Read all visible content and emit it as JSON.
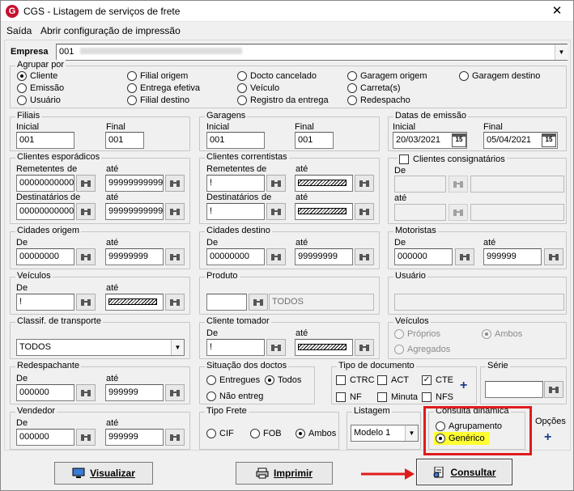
{
  "window": {
    "title": "CGS - Listagem de serviços de frete",
    "close": "✕",
    "logo": "G"
  },
  "menu": {
    "saida": "Saída",
    "config": "Abrir configuração de impressão"
  },
  "empresa": {
    "label": "Empresa",
    "value": "001"
  },
  "agrupar": {
    "legend": "Agrupar por",
    "options": [
      "Cliente",
      "Emissão",
      "Usuário",
      "Filial origem",
      "Entrega efetiva",
      "Filial destino",
      "Docto cancelado",
      "Veículo",
      "Registro da entrega",
      "Garagem origem",
      "Carreta(s)",
      "Redespacho",
      "Garagem destino"
    ],
    "selected": "Cliente"
  },
  "filiais": {
    "legend": "Filiais",
    "inicial_label": "Inicial",
    "final_label": "Final",
    "inicial": "001",
    "final": "001"
  },
  "garagens": {
    "legend": "Garagens",
    "inicial_label": "Inicial",
    "final_label": "Final",
    "inicial": "001",
    "final": "001"
  },
  "datas": {
    "legend": "Datas de emissão",
    "inicial_label": "Inicial",
    "final_label": "Final",
    "inicial": "20/03/2021",
    "final": "05/04/2021",
    "cal": "15"
  },
  "clientes_esporadicos": {
    "legend": "Clientes esporádicos",
    "rem_label": "Remetentes",
    "de": "de",
    "ate": "até",
    "rem_de": "00000000000",
    "rem_ate": "99999999999",
    "dest_label": "Destinatários",
    "dest_de": "00000000000",
    "dest_ate": "99999999999"
  },
  "clientes_correntistas": {
    "legend": "Clientes correntistas",
    "rem_label": "Remetentes",
    "de": "de",
    "ate": "até",
    "rem_de": "!",
    "dest_label": "Destinatários",
    "dest_de": "!"
  },
  "consignatarios": {
    "legend": "Clientes consignatários",
    "de": "De",
    "ate": "até"
  },
  "cidades_origem": {
    "legend": "Cidades origem",
    "de": "De",
    "ate": "até",
    "v_de": "00000000",
    "v_ate": "99999999"
  },
  "cidades_destino": {
    "legend": "Cidades destino",
    "de": "De",
    "ate": "até",
    "v_de": "00000000",
    "v_ate": "99999999"
  },
  "motoristas": {
    "legend": "Motoristas",
    "de": "De",
    "ate": "até",
    "v_de": "000000",
    "v_ate": "999999"
  },
  "veiculos": {
    "legend": "Veículos",
    "de": "De",
    "ate": "até",
    "v_de": "!"
  },
  "produto": {
    "legend": "Produto",
    "value": "TODOS"
  },
  "usuario": {
    "legend": "Usuário"
  },
  "classif": {
    "legend": "Classif. de transporte",
    "value": "TODOS"
  },
  "cliente_tomador": {
    "legend": "Cliente tomador",
    "de": "De",
    "ate": "até",
    "v_de": "!"
  },
  "veiculos2": {
    "legend": "Veículos",
    "options": [
      "Próprios",
      "Agregados",
      "Ambos"
    ],
    "selected": "Ambos"
  },
  "redespachante": {
    "legend": "Redespachante",
    "de": "De",
    "ate": "até",
    "v_de": "000000",
    "v_ate": "999999"
  },
  "situacao": {
    "legend": "Situação dos doctos",
    "options": [
      "Entregues",
      "Todos",
      "Não entreg"
    ],
    "selected": "Todos"
  },
  "tipo_doc": {
    "legend": "Tipo de documento",
    "items": [
      {
        "label": "CTRC",
        "checked": false
      },
      {
        "label": "ACT",
        "checked": false
      },
      {
        "label": "CTE",
        "checked": true
      },
      {
        "label": "NF",
        "checked": false
      },
      {
        "label": "Minuta",
        "checked": false
      },
      {
        "label": "NFS",
        "checked": false
      }
    ],
    "plus": "+"
  },
  "serie": {
    "legend": "Série"
  },
  "vendedor": {
    "legend": "Vendedor",
    "de": "De",
    "ate": "até",
    "v_de": "000000",
    "v_ate": "999999"
  },
  "tipo_frete": {
    "legend": "Tipo Frete",
    "options": [
      "CIF",
      "FOB",
      "Ambos"
    ],
    "selected": "Ambos"
  },
  "listagem": {
    "legend": "Listagem",
    "value": "Modelo 1"
  },
  "consulta": {
    "legend": "Consulta dinâmica",
    "options": [
      "Agrupamento",
      "Genérico"
    ],
    "selected": "Genérico"
  },
  "opcoes": {
    "label": "Opções",
    "plus": "+"
  },
  "buttons": {
    "visualizar": "Visualizar",
    "imprimir": "Imprimir",
    "consultar": "Consultar"
  },
  "colors": {
    "highlight_box": "#e01b1b",
    "highlight_fill": "#ffff33",
    "arrow": "#e01b1b"
  }
}
